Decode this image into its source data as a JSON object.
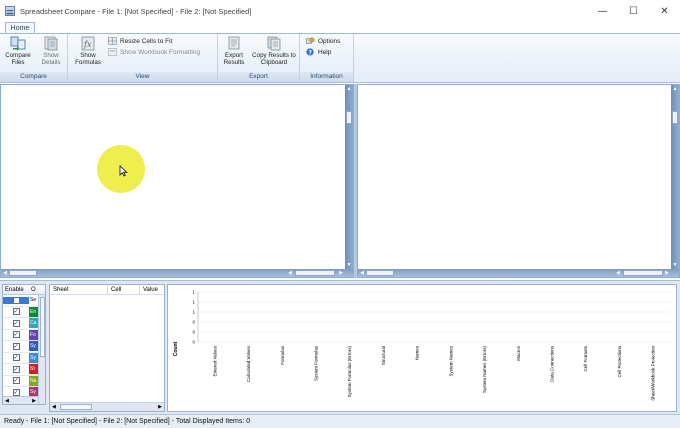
{
  "window": {
    "title": "Spreadsheet Compare - File 1: [Not Specified] - File 2: [Not Specified]",
    "minimize": "—",
    "maximize": "☐",
    "close": "✕"
  },
  "tabs": [
    {
      "label": "Home"
    }
  ],
  "ribbon": {
    "compare": {
      "group_label": "Compare",
      "compare_files": "Compare Files",
      "show_details": "Show Details"
    },
    "view": {
      "group_label": "View",
      "show_formulas": "Show Formulas",
      "resize_cells": "Resize Cells to Fit",
      "show_workbook_formatting": "Show Workbook Formatting"
    },
    "export": {
      "group_label": "Export",
      "export_results": "Export Results",
      "copy_results": "Copy Results to Clipboard"
    },
    "information": {
      "group_label": "Information",
      "options": "Options",
      "help": "Help"
    }
  },
  "enable_table": {
    "headers": [
      "Enable",
      "O",
      "Se"
    ],
    "rows": [
      {
        "checked": false,
        "color": "#1a6fd6",
        "label": "Se",
        "selected": true
      },
      {
        "checked": true,
        "color": "#0b8a2e",
        "label": "En"
      },
      {
        "checked": true,
        "color": "#2aa8b8",
        "label": "Ca"
      },
      {
        "checked": true,
        "color": "#6a3fb3",
        "label": "Fo"
      },
      {
        "checked": true,
        "color": "#2f5cc4",
        "label": "Sy"
      },
      {
        "checked": true,
        "color": "#3a8ad8",
        "label": "Sy"
      },
      {
        "checked": true,
        "color": "#d42020",
        "label": "St"
      },
      {
        "checked": true,
        "color": "#86a814",
        "label": "Na"
      },
      {
        "checked": true,
        "color": "#b03070",
        "label": "Sy"
      }
    ]
  },
  "diff_table": {
    "headers": [
      "Sheet",
      "Cell",
      "Value"
    ]
  },
  "chart_data": {
    "type": "bar",
    "ylabel": "Count",
    "ylim": [
      0,
      1
    ],
    "yticks": [
      "1",
      "1",
      "1",
      "0",
      "0",
      "0"
    ],
    "categories": [
      "Entered Values",
      "Calculated Values",
      "Formulas",
      "System Formulas",
      "System Formulas (Errors)",
      "Structural",
      "Names",
      "System Names",
      "System Names (Errors)",
      "Macros",
      "Data Connections",
      "Cell Formats",
      "Cell Protections",
      "Sheet/Workbook Protection"
    ],
    "values": [
      0,
      0,
      0,
      0,
      0,
      0,
      0,
      0,
      0,
      0,
      0,
      0,
      0,
      0
    ]
  },
  "status": {
    "text": "Ready - File 1: [Not Specified] - File 2: [Not Specified] - Total Displayed Items: 0"
  },
  "icons": {
    "app": "spreadsheet-compare-icon",
    "compare_files": "compare-files-icon",
    "show_details": "show-details-icon",
    "show_formulas": "show-formulas-icon",
    "resize": "resize-cells-icon",
    "workbook_formatting": "workbook-formatting-icon",
    "export": "export-icon",
    "copy": "copy-icon",
    "options": "options-icon",
    "help": "help-icon"
  }
}
